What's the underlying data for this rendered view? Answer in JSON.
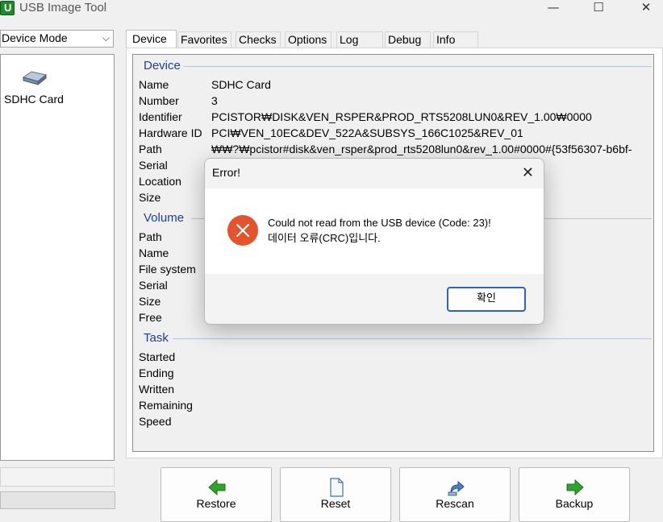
{
  "window": {
    "title": "USB Image Tool",
    "icon_letter": "U",
    "controls": {
      "minimize": "—",
      "maximize": "☐",
      "close": "✕"
    }
  },
  "sidebar": {
    "mode_select": {
      "value": "Device Mode",
      "chevron": "⌵"
    },
    "devices": [
      {
        "label": "SDHC Card",
        "icon": "sd-card-icon"
      }
    ]
  },
  "tabs": [
    {
      "label": "Device",
      "active": true
    },
    {
      "label": "Favorites",
      "active": false
    },
    {
      "label": "Checks",
      "active": false
    },
    {
      "label": "Options",
      "active": false
    },
    {
      "label": "Log",
      "active": false
    },
    {
      "label": "Debug",
      "active": false
    },
    {
      "label": "Info",
      "active": false
    }
  ],
  "device_group": {
    "title": "Device",
    "rows": [
      {
        "label": "Name",
        "value": "SDHC Card"
      },
      {
        "label": "Number",
        "value": "3"
      },
      {
        "label": "Identifier",
        "value": "PCISTOR₩DISK&VEN_RSPER&PROD_RTS5208LUN0&REV_1.00₩0000"
      },
      {
        "label": "Hardware ID",
        "value": "PCI₩VEN_10EC&DEV_522A&SUBSYS_166C1025&REV_01"
      },
      {
        "label": "Path",
        "value": "₩₩?₩pcistor#disk&ven_rsper&prod_rts5208lun0&rev_1.00#0000#{53f56307-b6bf-"
      },
      {
        "label": "Serial",
        "value": ""
      },
      {
        "label": "Location",
        "value": ""
      },
      {
        "label": "Size",
        "value": ""
      }
    ]
  },
  "volume_group": {
    "title": "Volume",
    "rows": [
      {
        "label": "Path",
        "value": ""
      },
      {
        "label": "Name",
        "value": ""
      },
      {
        "label": "File system",
        "value": ""
      },
      {
        "label": "Serial",
        "value": ""
      },
      {
        "label": "Size",
        "value": ""
      },
      {
        "label": "Free",
        "value": ""
      }
    ]
  },
  "task_group": {
    "title": "Task",
    "rows": [
      {
        "label": "Started",
        "value": ""
      },
      {
        "label": "Ending",
        "value": ""
      },
      {
        "label": "Written",
        "value": ""
      },
      {
        "label": "Remaining",
        "value": ""
      },
      {
        "label": "Speed",
        "value": ""
      }
    ]
  },
  "buttons": {
    "restore": {
      "label": "Restore",
      "icon": "arrow-left-icon"
    },
    "reset": {
      "label": "Reset",
      "icon": "document-icon"
    },
    "rescan": {
      "label": "Rescan",
      "icon": "refresh-icon"
    },
    "backup": {
      "label": "Backup",
      "icon": "arrow-right-icon"
    }
  },
  "dialog": {
    "title": "Error!",
    "close": "✕",
    "message_line1": "Could not read from the USB device (Code: 23)!",
    "message_line2": "데이터 오류(CRC)입니다.",
    "ok_label": "확인",
    "icon": "error-icon"
  },
  "colors": {
    "group_title": "#1e3d9b",
    "error_red": "#e5532c",
    "arrow_green": "#2da52d",
    "ok_border": "#2f64b7"
  }
}
